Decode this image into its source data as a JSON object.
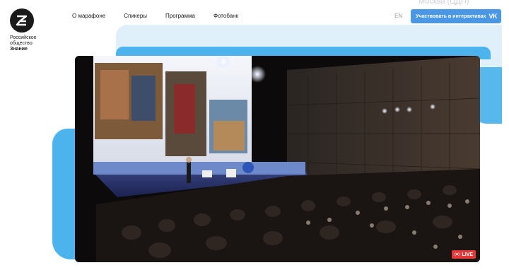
{
  "logo": {
    "line1": "Российское",
    "line2": "общество",
    "line3": "Знание"
  },
  "nav": [
    {
      "label": "О марафоне"
    },
    {
      "label": "Спикеры"
    },
    {
      "label": "Программа"
    },
    {
      "label": "Фотобанк"
    }
  ],
  "header": {
    "city": "Москва (ЦДП)",
    "lang": "EN",
    "cta_label": "Участвовать в интерактивах",
    "vk_icon": "VK"
  },
  "video": {
    "live_label": "LIVE",
    "live_icon": "broadcast-icon"
  },
  "colors": {
    "accent": "#4a97e6",
    "blob_blue": "#4db3ec",
    "blob_light": "#dff0fa",
    "live_red": "#e23838"
  }
}
